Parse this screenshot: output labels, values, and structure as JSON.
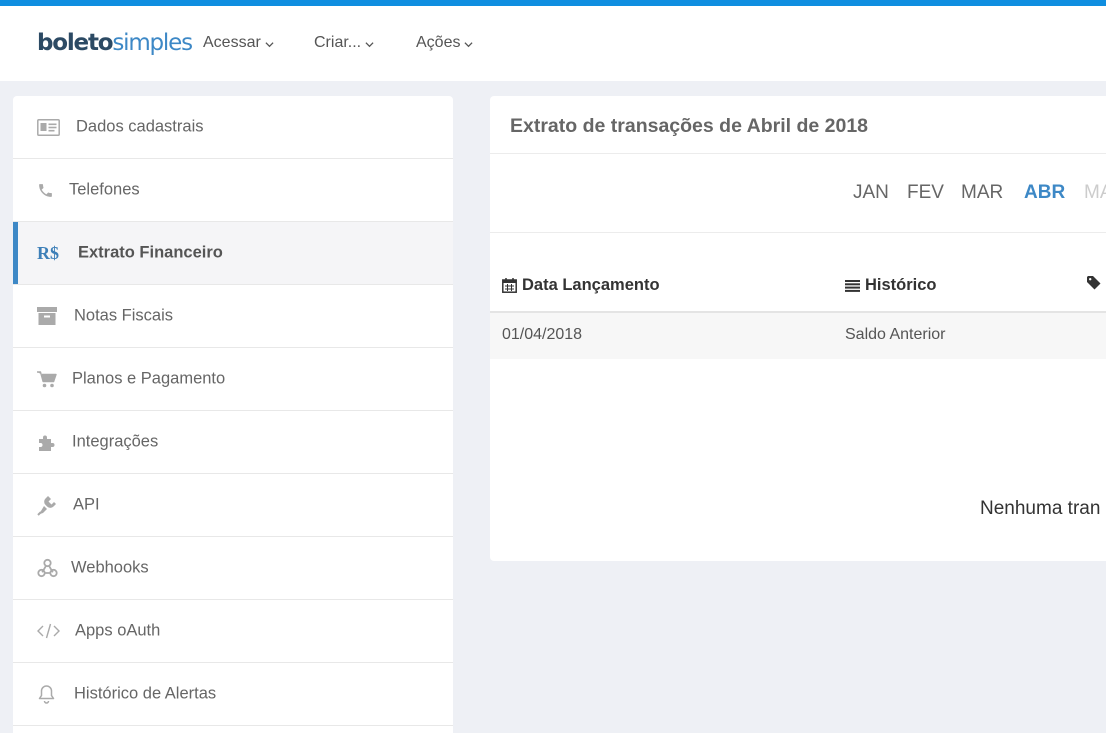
{
  "brand": {
    "part1": "boleto",
    "part2": "simples"
  },
  "nav": {
    "items": [
      "Acessar",
      "Criar...",
      "Ações"
    ]
  },
  "sidebar": {
    "items": [
      {
        "label": "Dados cadastrais",
        "icon": "id-card-icon"
      },
      {
        "label": "Telefones",
        "icon": "phone-icon"
      },
      {
        "label": "Extrato Financeiro",
        "icon": "rs-currency-icon",
        "icon_text": "R$",
        "active": true
      },
      {
        "label": "Notas Fiscais",
        "icon": "archive-icon"
      },
      {
        "label": "Planos e Pagamento",
        "icon": "cart-icon"
      },
      {
        "label": "Integrações",
        "icon": "puzzle-icon"
      },
      {
        "label": "API",
        "icon": "plug-icon"
      },
      {
        "label": "Webhooks",
        "icon": "webhook-icon"
      },
      {
        "label": "Apps oAuth",
        "icon": "code-icon"
      },
      {
        "label": "Histórico de Alertas",
        "icon": "bell-icon"
      }
    ]
  },
  "main": {
    "title": "Extrato de transações de Abril de 2018",
    "months": [
      {
        "label": "JAN"
      },
      {
        "label": "FEV"
      },
      {
        "label": "MAR"
      },
      {
        "label": "ABR",
        "active": true
      },
      {
        "label": "MA",
        "disabled": true
      }
    ],
    "table": {
      "headers": [
        "Data Lançamento",
        "Histórico"
      ],
      "rows": [
        {
          "date": "01/04/2018",
          "history": "Saldo Anterior"
        }
      ]
    },
    "empty_message": "Nenhuma tran"
  },
  "colors": {
    "accent": "#3d88c6",
    "top_stripe": "#0f8ee0",
    "background": "#eef0f5"
  }
}
